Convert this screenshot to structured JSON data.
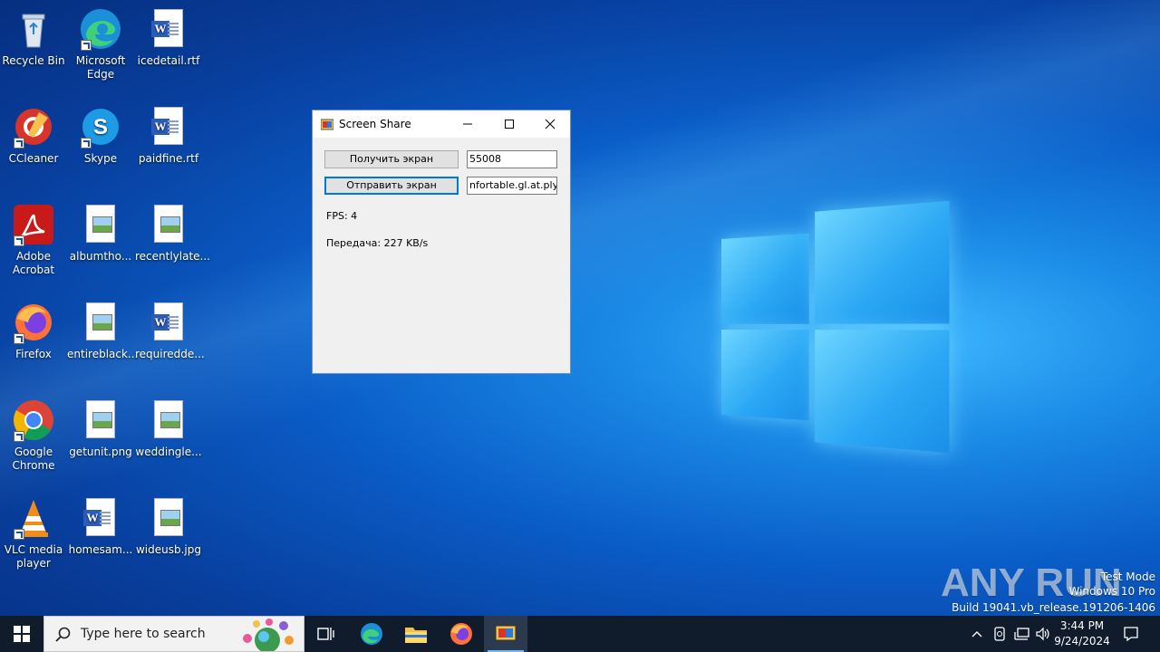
{
  "desktop": {
    "icons": [
      {
        "label": "Recycle Bin"
      },
      {
        "label": "Microsoft Edge"
      },
      {
        "label": "icedetail.rtf"
      },
      {
        "label": "CCleaner"
      },
      {
        "label": "Skype"
      },
      {
        "label": "paidfine.rtf"
      },
      {
        "label": "Adobe Acrobat"
      },
      {
        "label": "albumtho..."
      },
      {
        "label": "recentlylate..."
      },
      {
        "label": "Firefox"
      },
      {
        "label": "entireblack..."
      },
      {
        "label": "requiredde..."
      },
      {
        "label": "Google Chrome"
      },
      {
        "label": "getunit.png"
      },
      {
        "label": "weddingle..."
      },
      {
        "label": "VLC media player"
      },
      {
        "label": "homesam..."
      },
      {
        "label": "wideusb.jpg"
      }
    ]
  },
  "window": {
    "title": "Screen Share",
    "get_screen_button": "Получить экран",
    "send_screen_button": "Отправить экран",
    "port_value": "55008",
    "host_value": "nfortable.gl.at.ply.gg",
    "fps_label": "FPS: 4",
    "transfer_label": "Передача: 227 KB/s"
  },
  "watermark": {
    "brand": "ANY RUN",
    "line1": "Test Mode",
    "line2": "Windows 10 Pro",
    "line3": "Build 19041.vb_release.191206-1406"
  },
  "taskbar": {
    "search_placeholder": "Type here to search",
    "time": "3:44 PM",
    "date": "9/24/2024"
  },
  "colors": {
    "accent": "#0078d7",
    "taskbar": "#101c2c"
  }
}
